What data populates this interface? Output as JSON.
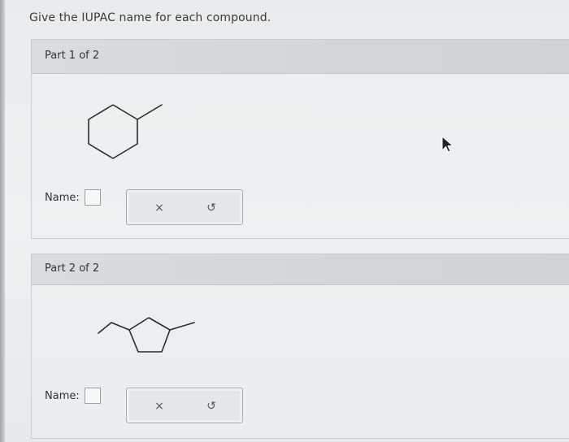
{
  "question": {
    "title": "Give the IUPAC name for each compound."
  },
  "parts": [
    {
      "header": "Part 1 of 2",
      "molecule_icon": "methylcyclohexane-structure",
      "name_label": "Name:",
      "name_value": "",
      "clear_icon": "×",
      "undo_icon": "↺"
    },
    {
      "header": "Part 2 of 2",
      "molecule_icon": "ethylmethylcyclopentane-structure",
      "name_label": "Name:",
      "name_value": "",
      "clear_icon": "×",
      "undo_icon": "↺"
    }
  ],
  "colors": {
    "bond": "#2b2b2b",
    "header_bg": "#d4d8da",
    "border": "#c9cdd0"
  }
}
